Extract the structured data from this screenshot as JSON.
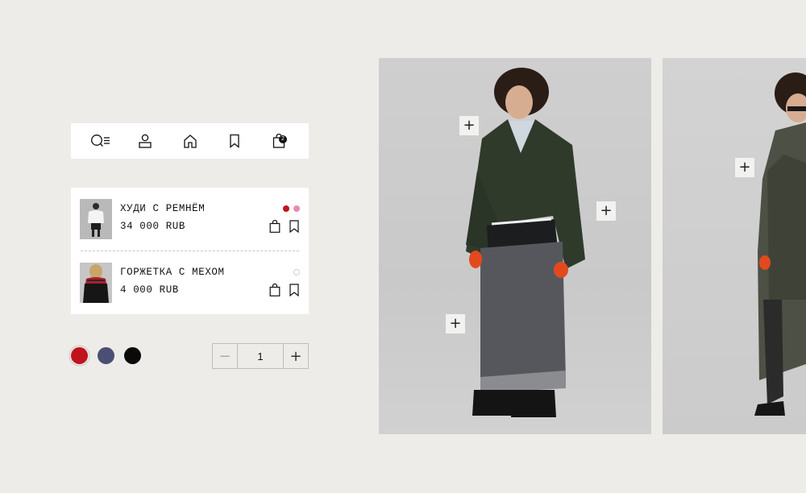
{
  "nav": {
    "items": [
      {
        "name": "search-menu",
        "icon": "search-menu-icon"
      },
      {
        "name": "account",
        "icon": "user-icon"
      },
      {
        "name": "home",
        "icon": "home-icon"
      },
      {
        "name": "wishlist",
        "icon": "bookmark-icon"
      },
      {
        "name": "cart",
        "icon": "shopping-bag-icon"
      }
    ],
    "cart_count": "2"
  },
  "cart": {
    "items": [
      {
        "name": "ХУДИ С РЕМНЁМ",
        "price": "34 000 RUB",
        "colors": [
          "#c0141d",
          "#e98ab4"
        ]
      },
      {
        "name": "ГОРЖЕТКА С МЕХОМ",
        "price": "4 000 RUB",
        "colors": [
          "#ffffff"
        ]
      }
    ]
  },
  "color_options": [
    {
      "hex": "#c0141d",
      "selected": true
    },
    {
      "hex": "#4b4f74",
      "selected": false
    },
    {
      "hex": "#0a0a0a",
      "selected": false
    }
  ],
  "quantity": {
    "value": "1",
    "minus": "−",
    "plus": "+"
  },
  "hotspots": {
    "symbol": "+"
  }
}
